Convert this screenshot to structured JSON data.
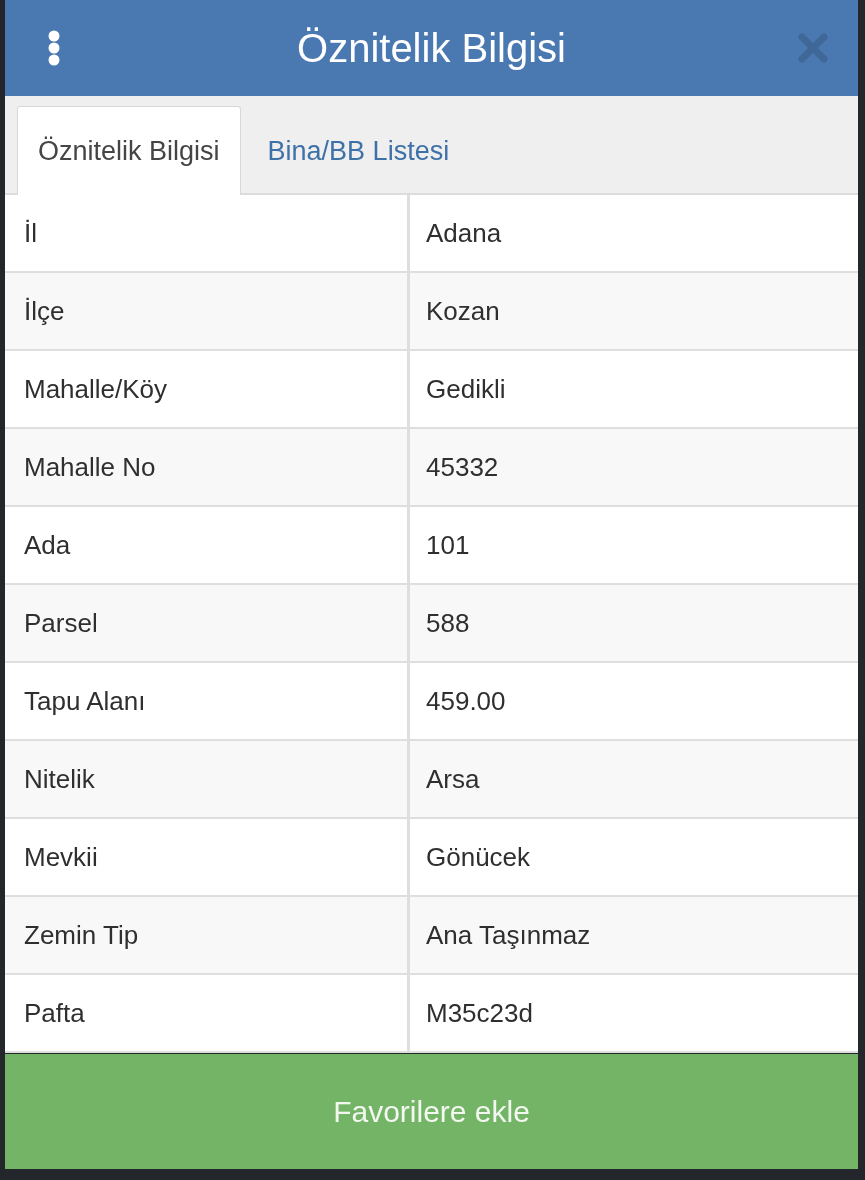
{
  "header": {
    "title": "Öznitelik Bilgisi"
  },
  "tabs": [
    {
      "label": "Öznitelik Bilgisi",
      "selected": true
    },
    {
      "label": "Bina/BB Listesi",
      "selected": false
    }
  ],
  "table": {
    "rows": [
      {
        "label": "İl",
        "value": "Adana"
      },
      {
        "label": "İlçe",
        "value": "Kozan"
      },
      {
        "label": "Mahalle/Köy",
        "value": "Gedikli"
      },
      {
        "label": "Mahalle No",
        "value": "45332"
      },
      {
        "label": "Ada",
        "value": "101"
      },
      {
        "label": "Parsel",
        "value": "588"
      },
      {
        "label": "Tapu Alanı",
        "value": "459.00"
      },
      {
        "label": "Nitelik",
        "value": "Arsa"
      },
      {
        "label": "Mevkii",
        "value": "Gönücek"
      },
      {
        "label": "Zemin Tip",
        "value": "Ana Taşınmaz"
      },
      {
        "label": "Pafta",
        "value": "M35c23d"
      }
    ]
  },
  "button": {
    "label": "Favorilere ekle"
  }
}
